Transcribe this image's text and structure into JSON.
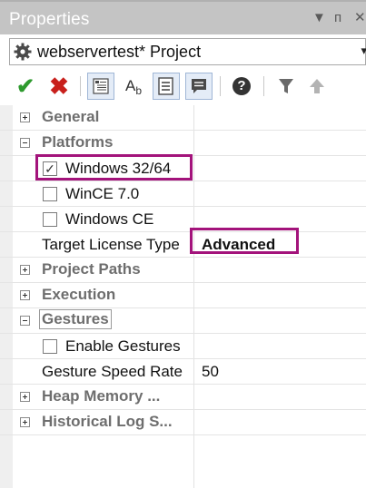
{
  "window": {
    "title": "Properties",
    "dropdown_glyph": "▼",
    "pin_glyph": "ᴨ",
    "close_glyph": "✕"
  },
  "selector": {
    "label": "webservertest* Project",
    "arrow": "▾"
  },
  "toolbar": {
    "ok_glyph": "✔",
    "cancel_glyph": "✖",
    "help_glyph": "?",
    "sort_glyph": "A",
    "sort_sub": "b"
  },
  "grid": {
    "categories": {
      "general": "General",
      "platforms": "Platforms",
      "project_paths": "Project Paths",
      "execution": "Execution",
      "gestures": "Gestures",
      "heap_memory": "Heap Memory ...",
      "historical_log": "Historical Log S..."
    },
    "platforms": [
      {
        "label": "Windows 32/64",
        "checked": true
      },
      {
        "label": "WinCE 7.0",
        "checked": false
      },
      {
        "label": "Windows CE",
        "checked": false
      }
    ],
    "check_mark": "✓",
    "target_license": {
      "label": "Target License Type",
      "value": "Advanced"
    },
    "enable_gestures": {
      "label": "Enable Gestures",
      "checked": false
    },
    "gesture_speed": {
      "label": "Gesture Speed Rate",
      "value": "50"
    }
  },
  "colors": {
    "highlight": "#a3137b",
    "ok_green": "#2e9a2e",
    "cancel_red": "#c8201c"
  }
}
